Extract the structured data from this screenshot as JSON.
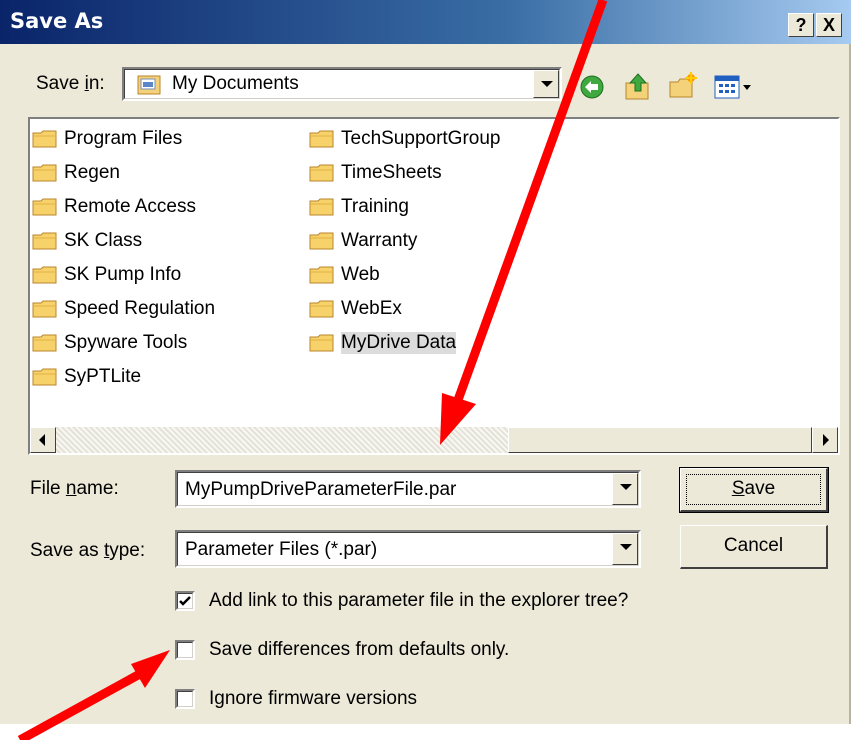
{
  "window": {
    "title": "Save As",
    "help_button": "?",
    "close_button": "X"
  },
  "save_in": {
    "label_prefix": "Save ",
    "label_access": "i",
    "label_suffix": "n:",
    "value": "My Documents"
  },
  "toolbar": {
    "icons": [
      "back-icon",
      "up-folder-icon",
      "new-folder-icon",
      "view-menu-icon"
    ]
  },
  "files": {
    "col1": [
      "Program Files",
      "Regen",
      "Remote Access",
      "SK Class",
      "SK Pump Info",
      "Speed Regulation",
      "Spyware Tools",
      "SyPTLite"
    ],
    "col2": [
      "TechSupportGroup",
      "TimeSheets",
      "Training",
      "Warranty",
      "Web",
      "WebEx",
      "MyDrive Data"
    ],
    "selected": "MyDrive Data"
  },
  "file_name": {
    "label_prefix": "File ",
    "label_access": "n",
    "label_suffix": "ame:",
    "value": "MyPumpDriveParameterFile.par"
  },
  "save_type": {
    "label_prefix": "Save as ",
    "label_access": "t",
    "label_suffix": "ype:",
    "value": "Parameter Files (*.par)"
  },
  "buttons": {
    "save_access": "S",
    "save_rest": "ave",
    "cancel": "Cancel"
  },
  "options": [
    {
      "label": "Add link to this parameter file in the explorer tree?",
      "checked": true
    },
    {
      "label": "Save differences from defaults only.",
      "checked": false
    },
    {
      "label": "Ignore firmware versions",
      "checked": false
    }
  ],
  "annotation": {
    "arrow_color": "#ff0000"
  }
}
